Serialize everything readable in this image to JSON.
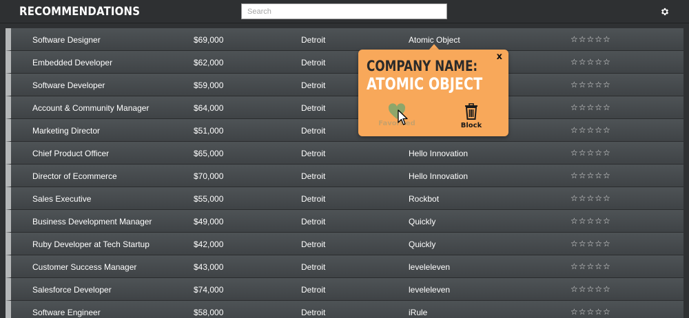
{
  "header": {
    "title": "RECOMMENDATIONS",
    "search_placeholder": "Search",
    "settings_icon": "gear-icon"
  },
  "rows": [
    {
      "title": "Software Designer",
      "salary": "$69,000",
      "city": "Detroit",
      "company": "Atomic Object",
      "rating": 0
    },
    {
      "title": "Embedded Developer",
      "salary": "$62,000",
      "city": "Detroit",
      "company": "",
      "rating": 0
    },
    {
      "title": "Software Developer",
      "salary": "$59,000",
      "city": "Detroit",
      "company": "",
      "rating": 0
    },
    {
      "title": "Account & Community Manager",
      "salary": "$64,000",
      "city": "Detroit",
      "company": "",
      "rating": 0
    },
    {
      "title": "Marketing Director",
      "salary": "$51,000",
      "city": "Detroit",
      "company": "",
      "rating": 0
    },
    {
      "title": "Chief Product Officer",
      "salary": "$65,000",
      "city": "Detroit",
      "company": "Hello Innovation",
      "rating": 0
    },
    {
      "title": "Director of Ecommerce",
      "salary": "$70,000",
      "city": "Detroit",
      "company": "Hello Innovation",
      "rating": 0
    },
    {
      "title": "Sales Executive",
      "salary": "$55,000",
      "city": "Detroit",
      "company": "Rockbot",
      "rating": 0
    },
    {
      "title": "Business Development Manager",
      "salary": "$49,000",
      "city": "Detroit",
      "company": "Quickly",
      "rating": 0
    },
    {
      "title": "Ruby Developer at Tech Startup",
      "salary": "$42,000",
      "city": "Detroit",
      "company": "Quickly",
      "rating": 0
    },
    {
      "title": "Customer Success Manager",
      "salary": "$43,000",
      "city": "Detroit",
      "company": "leveleleven",
      "rating": 0
    },
    {
      "title": "Salesforce Developer",
      "salary": "$74,000",
      "city": "Detroit",
      "company": "leveleleven",
      "rating": 0
    },
    {
      "title": "Software Engineer",
      "salary": "$58,000",
      "city": "Detroit",
      "company": "iRule",
      "rating": 0
    }
  ],
  "popup": {
    "close_label": "x",
    "label": "COMPANY NAME:",
    "company": "ATOMIC OBJECT",
    "favorite_label": "Favorited",
    "block_label": "Block",
    "favorite_icon": "heart-icon",
    "block_icon": "trash-icon"
  },
  "colors": {
    "background": "#2f3133",
    "row": "#474b4e",
    "popup": "#f8a85a",
    "heart": "#8ea66a"
  }
}
